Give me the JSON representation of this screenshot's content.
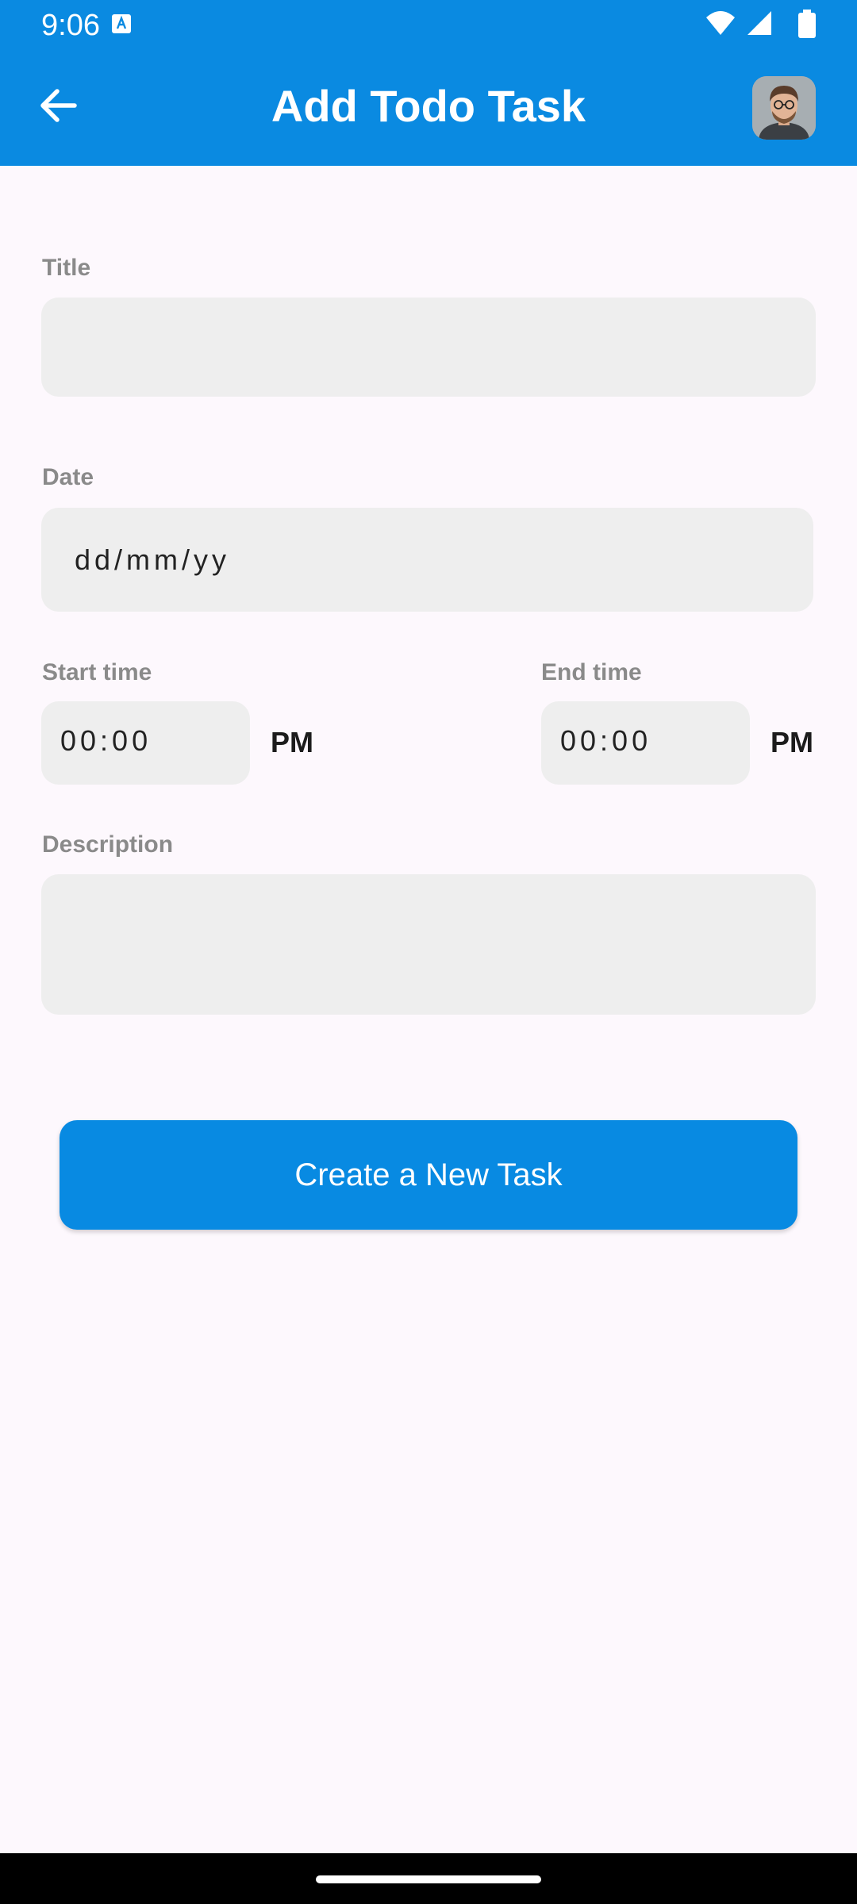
{
  "status_bar": {
    "time": "9:06"
  },
  "app_bar": {
    "title": "Add Todo Task",
    "back_icon": "arrow-left-icon",
    "avatar": "user-avatar"
  },
  "form": {
    "title_label": "Title",
    "title_value": "",
    "date_label": "Date",
    "date_placeholder": "dd/mm/yy",
    "start_time_label": "Start time",
    "start_time_value": "00:00",
    "start_time_ampm": "PM",
    "end_time_label": "End time",
    "end_time_value": "00:00",
    "end_time_ampm": "PM",
    "description_label": "Description",
    "description_value": ""
  },
  "actions": {
    "create_label": "Create a New Task"
  },
  "colors": {
    "primary": "#0a8ae1",
    "background": "#fdf8fd",
    "field_bg": "#eeeeee",
    "label": "#8a8a8a"
  }
}
